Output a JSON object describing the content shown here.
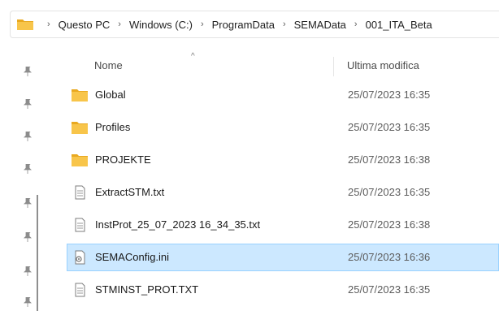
{
  "breadcrumb": {
    "items": [
      "Questo PC",
      "Windows (C:)",
      "ProgramData",
      "SEMAData",
      "001_ITA_Beta"
    ],
    "separator": "›"
  },
  "columns": {
    "name": "Nome",
    "modified": "Ultima modifica"
  },
  "files": [
    {
      "name": "Global",
      "modified": "25/07/2023 16:35",
      "type": "folder"
    },
    {
      "name": "Profiles",
      "modified": "25/07/2023 16:35",
      "type": "folder"
    },
    {
      "name": "PROJEKTE",
      "modified": "25/07/2023 16:38",
      "type": "folder"
    },
    {
      "name": "ExtractSTM.txt",
      "modified": "25/07/2023 16:35",
      "type": "text"
    },
    {
      "name": "InstProt_25_07_2023 16_34_35.txt",
      "modified": "25/07/2023 16:38",
      "type": "text"
    },
    {
      "name": "SEMAConfig.ini",
      "modified": "25/07/2023 16:36",
      "type": "ini",
      "selected": true
    },
    {
      "name": "STMINST_PROT.TXT",
      "modified": "25/07/2023 16:35",
      "type": "text"
    }
  ],
  "colors": {
    "folder": "#f8c54a",
    "selection_bg": "#cce8ff",
    "selection_border": "#99d1ff"
  }
}
